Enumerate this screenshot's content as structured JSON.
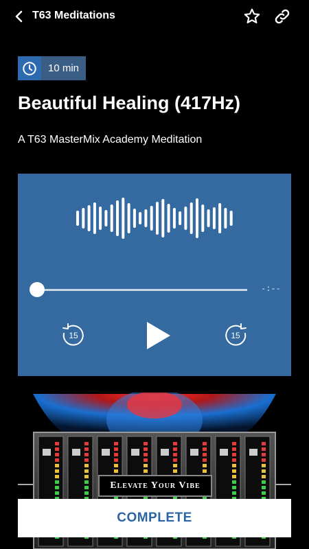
{
  "header": {
    "title": "T63 Meditations",
    "back_icon": "chevron-left-icon",
    "favorite_icon": "star-icon",
    "share_icon": "link-icon"
  },
  "duration": {
    "icon": "clock-icon",
    "label": "10 min"
  },
  "meditation": {
    "title": "Beautiful Healing (417Hz)",
    "subtitle": "A T63 MasterMix Academy Meditation"
  },
  "player": {
    "progress": 0,
    "time_remaining": "-:--",
    "rewind_label": "15",
    "forward_label": "15",
    "background_color": "#346aa0"
  },
  "artwork": {
    "banner_text": "Elevate Your Vibe"
  },
  "actions": {
    "complete_label": "COMPLETE"
  }
}
